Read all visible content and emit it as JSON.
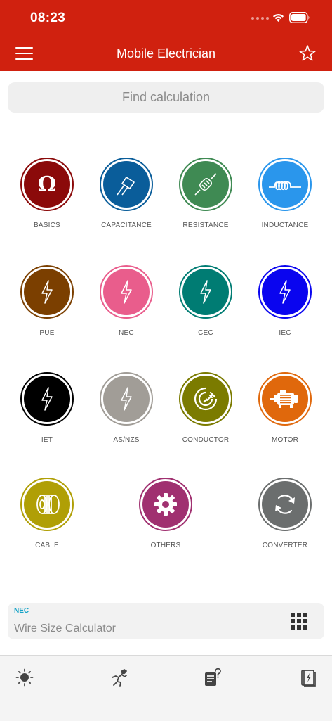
{
  "status_bar": {
    "time": "08:23"
  },
  "header": {
    "title": "Mobile Electrician"
  },
  "search": {
    "placeholder": "Find calculation"
  },
  "categories": [
    {
      "label": "BASICS",
      "color": "#8b0a0a",
      "icon": "omega-icon"
    },
    {
      "label": "CAPACITANCE",
      "color": "#0a5d9a",
      "icon": "capacitor-icon"
    },
    {
      "label": "RESISTANCE",
      "color": "#3f8a53",
      "icon": "resistor-icon"
    },
    {
      "label": "INDUCTANCE",
      "color": "#2a96ec",
      "icon": "coil-icon"
    },
    {
      "label": "PUE",
      "color": "#7b3f00",
      "icon": "lightning-icon"
    },
    {
      "label": "NEC",
      "color": "#e95d8c",
      "icon": "lightning-icon"
    },
    {
      "label": "CEC",
      "color": "#007c73",
      "icon": "lightning-icon"
    },
    {
      "label": "IEC",
      "color": "#0a05ef",
      "icon": "lightning-icon"
    },
    {
      "label": "IET",
      "color": "#000000",
      "icon": "lightning-icon"
    },
    {
      "label": "AS/NZS",
      "color": "#a19d97",
      "icon": "lightning-icon"
    },
    {
      "label": "CONDUCTOR",
      "color": "#7b7b00",
      "icon": "plug-icon"
    },
    {
      "label": "MOTOR",
      "color": "#e0680c",
      "icon": "motor-icon"
    },
    {
      "label": "CABLE",
      "color": "#b09f06",
      "icon": "cable-reel-icon"
    },
    {
      "label": "OTHERS",
      "color": "#a03070",
      "icon": "gear-icon"
    },
    {
      "label": "CONVERTER",
      "color": "#6b6e6e",
      "icon": "refresh-icon"
    }
  ],
  "recent": {
    "tag": "NEC",
    "title": "Wire Size Calculator"
  },
  "tabbar": [
    {
      "icon": "sun-icon"
    },
    {
      "icon": "electrician-icon"
    },
    {
      "icon": "document-question-icon"
    },
    {
      "icon": "book-icon"
    }
  ],
  "colors": {
    "brand": "#d0210f",
    "accent": "#16a3c7"
  }
}
